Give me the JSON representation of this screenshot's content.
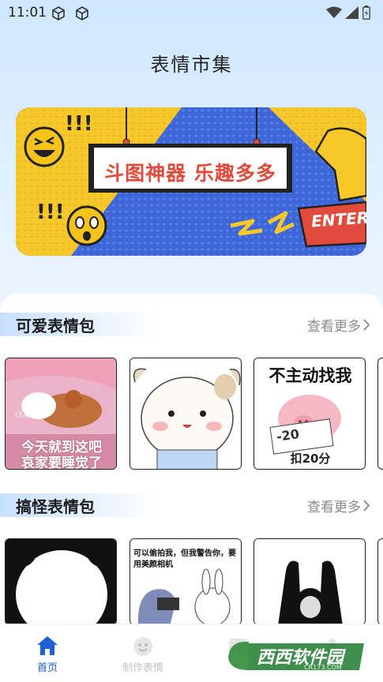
{
  "status_bar": {
    "time": "11:01"
  },
  "page_title": "表情市集",
  "banner": {
    "headline": "斗图神器 乐趣多多",
    "exclaim_top": "!!!",
    "exclaim_bottom": "!!!",
    "key_label": "ENTER"
  },
  "sections": [
    {
      "title": "可爱表情包",
      "more_label": "查看更多",
      "cards": [
        {
          "caption_line1": "今天就到这吧",
          "caption_line2": "哀家要睡觉了",
          "badge": "(王者手语)"
        },
        {
          "caption_line1": ""
        },
        {
          "caption_top": "不主动找我",
          "caption_bottom": "扣20分",
          "note": "-20"
        }
      ]
    },
    {
      "title": "搞怪表情包",
      "more_label": "查看更多",
      "cards": [
        {
          "caption_line1": ""
        },
        {
          "caption_top": "可以偷拍我，但我警告你，要用美颜相机"
        },
        {
          "caption_line1": ""
        }
      ]
    }
  ],
  "tab_bar": {
    "tabs": [
      {
        "label": "首页",
        "active": true
      },
      {
        "label": "制作表情",
        "active": false
      },
      {
        "label": "",
        "active": false
      },
      {
        "label": "",
        "active": false
      }
    ]
  },
  "watermark": {
    "text": "西西软件园",
    "sub": "CR173.COM"
  },
  "colors": {
    "accent": "#1f5fd6",
    "inactive": "#b5b5b5",
    "banner_blue": "#3d66d8",
    "banner_yellow": "#f7c82a"
  }
}
